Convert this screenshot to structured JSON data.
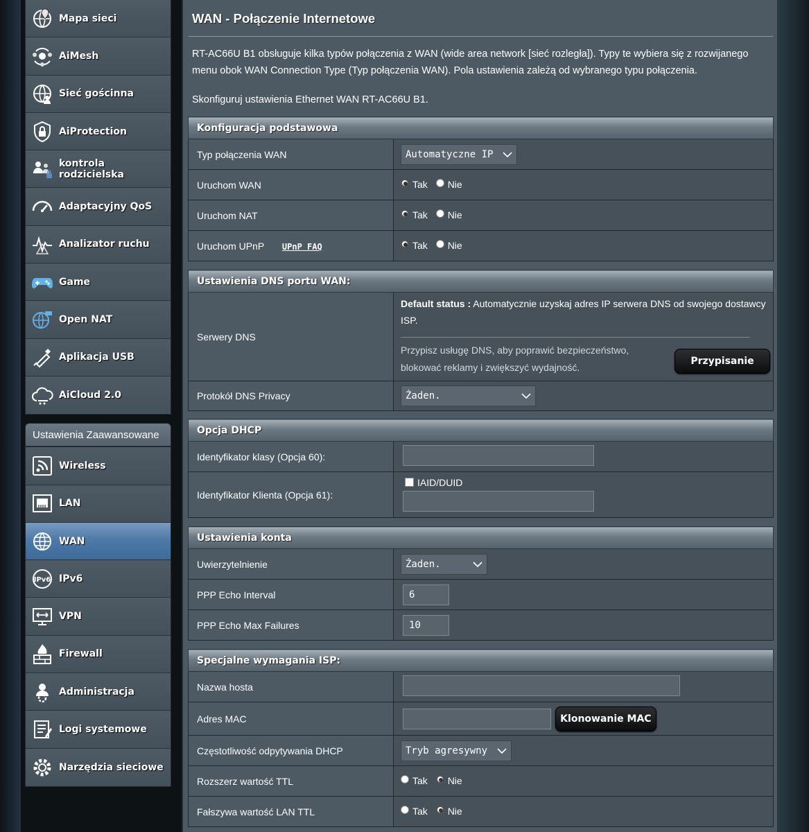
{
  "sidebar": {
    "top_items": [
      {
        "label": "Mapa sieci",
        "icon": "network-map-icon"
      },
      {
        "label": "AiMesh",
        "icon": "aimesh-icon"
      },
      {
        "label": "Sieć gościnna",
        "icon": "guest-network-icon"
      },
      {
        "label": "AiProtection",
        "icon": "shield-lock-icon"
      },
      {
        "label": "kontrola rodzicielska",
        "icon": "parental-control-icon"
      },
      {
        "label": "Adaptacyjny QoS",
        "icon": "speedometer-icon"
      },
      {
        "label": "Analizator ruchu",
        "icon": "traffic-analyzer-icon"
      },
      {
        "label": "Game",
        "icon": "gamepad-icon"
      },
      {
        "label": "Open NAT",
        "icon": "open-nat-icon"
      },
      {
        "label": "Aplikacja USB",
        "icon": "usb-icon"
      },
      {
        "label": "AiCloud 2.0",
        "icon": "cloud-icon"
      }
    ],
    "advanced_header": "Ustawienia Zaawansowane",
    "advanced_items": [
      {
        "label": "Wireless",
        "icon": "wireless-icon"
      },
      {
        "label": "LAN",
        "icon": "lan-icon"
      },
      {
        "label": "WAN",
        "icon": "globe-icon",
        "active": true
      },
      {
        "label": "IPv6",
        "icon": "ipv6-icon"
      },
      {
        "label": "VPN",
        "icon": "vpn-icon"
      },
      {
        "label": "Firewall",
        "icon": "firewall-icon"
      },
      {
        "label": "Administracja",
        "icon": "admin-gear-icon"
      },
      {
        "label": "Logi systemowe",
        "icon": "system-log-icon"
      },
      {
        "label": "Narzędzia sieciowe",
        "icon": "network-tools-icon"
      }
    ]
  },
  "main": {
    "title": "WAN - Połączenie Internetowe",
    "description": "RT-AC66U B1 obsługuje kilka typów połączenia z WAN (wide area network [sieć rozległa]). Typy te wybiera się z rozwijanego menu obok WAN Connection Type (Typ połączenia WAN). Pola ustawienia zależą od wybranego typu połączenia.",
    "subdescription": "Skonfiguruj ustawienia Ethernet WAN RT-AC66U B1."
  },
  "basic": {
    "header": "Konfiguracja podstawowa",
    "wan_type_label": "Typ połączenia WAN",
    "wan_type_value": "Automatyczne IP",
    "enable_wan_label": "Uruchom WAN",
    "enable_nat_label": "Uruchom NAT",
    "enable_upnp_label": "Uruchom UPnP",
    "upnp_faq": "UPnP FAQ",
    "yes": "Tak",
    "no": "Nie"
  },
  "dns": {
    "header": "Ustawienia DNS portu WAN:",
    "servers_label": "Serwery DNS",
    "default_status_label": "Default status :",
    "default_status_text": "Automatycznie uzyskaj adres IP serwera DNS od swojego dostawcy ISP.",
    "hint": "Przypisz usługę DNS, aby poprawić bezpieczeństwo, blokować reklamy i zwiększyć wydajność.",
    "assign_button": "Przypisanie",
    "privacy_label": "Protokół DNS Privacy",
    "privacy_value": "Żaden."
  },
  "dhcp": {
    "header": "Opcja DHCP",
    "class_id_label": "Identyfikator klasy (Opcja 60):",
    "class_id_value": "",
    "client_id_label": "Identyfikator Klienta (Opcja 61):",
    "iaid_label": "IAID/DUID",
    "client_id_value": ""
  },
  "account": {
    "header": "Ustawienia konta",
    "auth_label": "Uwierzytelnienie",
    "auth_value": "Żaden.",
    "echo_interval_label": "PPP Echo Interval",
    "echo_interval_value": "6",
    "echo_max_label": "PPP Echo Max Failures",
    "echo_max_value": "10"
  },
  "isp": {
    "header": "Specjalne wymagania ISP:",
    "hostname_label": "Nazwa hosta",
    "hostname_value": "",
    "mac_label": "Adres MAC",
    "mac_value": "",
    "mac_clone_button": "Klonowanie MAC",
    "dhcp_query_label": "Częstotliwość odpytywania DHCP",
    "dhcp_query_value": "Tryb agresywny",
    "extend_ttl_label": "Rozszerz wartość TTL",
    "spoof_ttl_label": "Fałszywa wartość LAN TTL",
    "yes": "Tak",
    "no": "Nie"
  }
}
